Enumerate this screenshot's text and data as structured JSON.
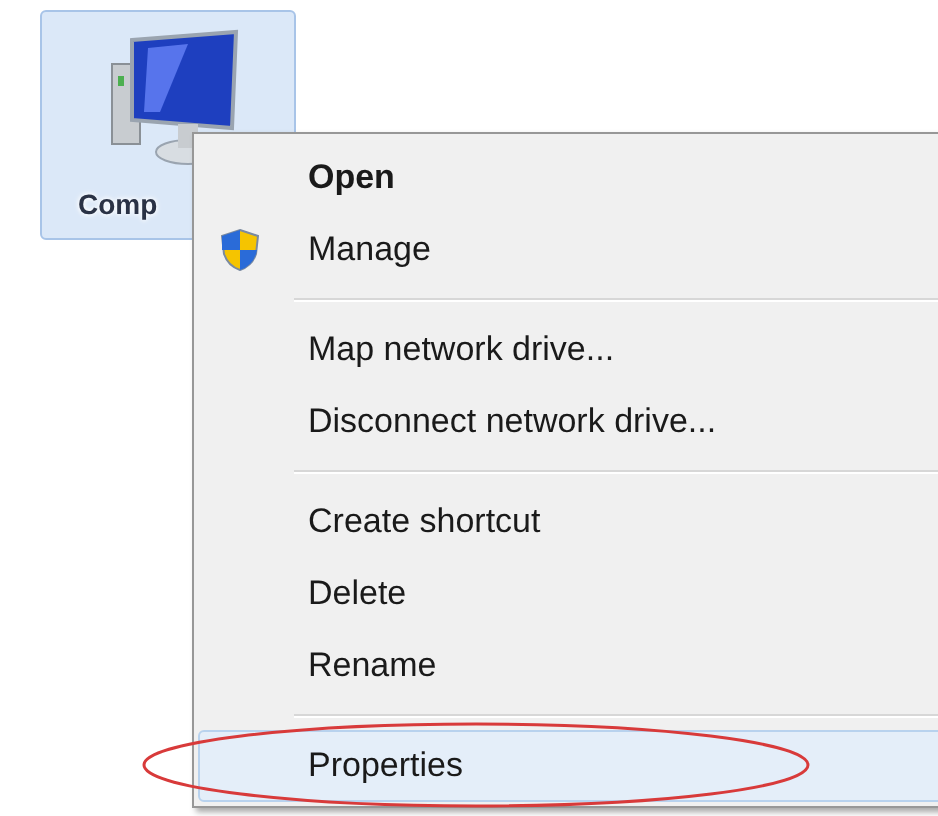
{
  "desktop_icon": {
    "label": "Comp",
    "selected": true
  },
  "context_menu": {
    "groups": [
      {
        "items": [
          {
            "label": "Open",
            "default": true,
            "kind": "plain",
            "selected": false
          },
          {
            "label": "Manage",
            "default": false,
            "kind": "shield",
            "selected": false
          }
        ]
      },
      {
        "items": [
          {
            "label": "Map network drive...",
            "default": false,
            "kind": "plain",
            "selected": false
          },
          {
            "label": "Disconnect network drive...",
            "default": false,
            "kind": "plain",
            "selected": false
          }
        ]
      },
      {
        "items": [
          {
            "label": "Create shortcut",
            "default": false,
            "kind": "plain",
            "selected": false
          },
          {
            "label": "Delete",
            "default": false,
            "kind": "plain",
            "selected": false
          },
          {
            "label": "Rename",
            "default": false,
            "kind": "plain",
            "selected": false
          }
        ]
      },
      {
        "items": [
          {
            "label": "Properties",
            "default": false,
            "kind": "plain",
            "selected": true
          }
        ]
      }
    ]
  }
}
